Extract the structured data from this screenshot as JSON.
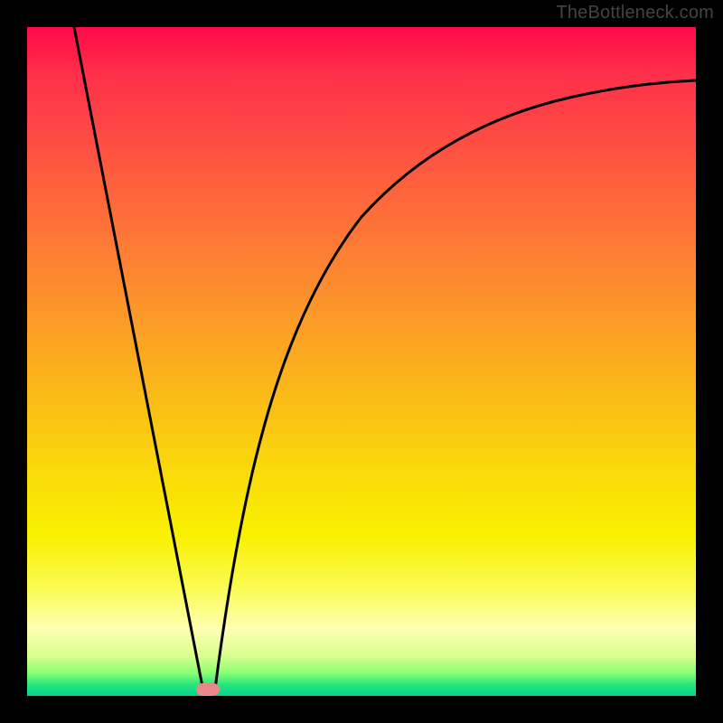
{
  "watermark": "TheBottleneck.com",
  "chart_data": {
    "type": "line",
    "title": "",
    "xlabel": "",
    "ylabel": "",
    "xlim": [
      0,
      1
    ],
    "ylim": [
      0,
      1
    ],
    "series": [
      {
        "name": "left-branch",
        "x": [
          0.07,
          0.115,
          0.16,
          0.205,
          0.25,
          0.265
        ],
        "y": [
          1.0,
          0.8,
          0.6,
          0.4,
          0.15,
          0.0
        ]
      },
      {
        "name": "right-branch",
        "x": [
          0.28,
          0.3,
          0.33,
          0.37,
          0.42,
          0.48,
          0.56,
          0.66,
          0.78,
          0.9,
          1.0
        ],
        "y": [
          0.0,
          0.16,
          0.33,
          0.49,
          0.615,
          0.71,
          0.79,
          0.845,
          0.885,
          0.91,
          0.92
        ]
      }
    ],
    "marker": {
      "x": 0.27,
      "y": 0.003
    },
    "gradient_note": "Background encodes bottleneck severity: red (high) at top through yellow to green (low) at bottom."
  }
}
